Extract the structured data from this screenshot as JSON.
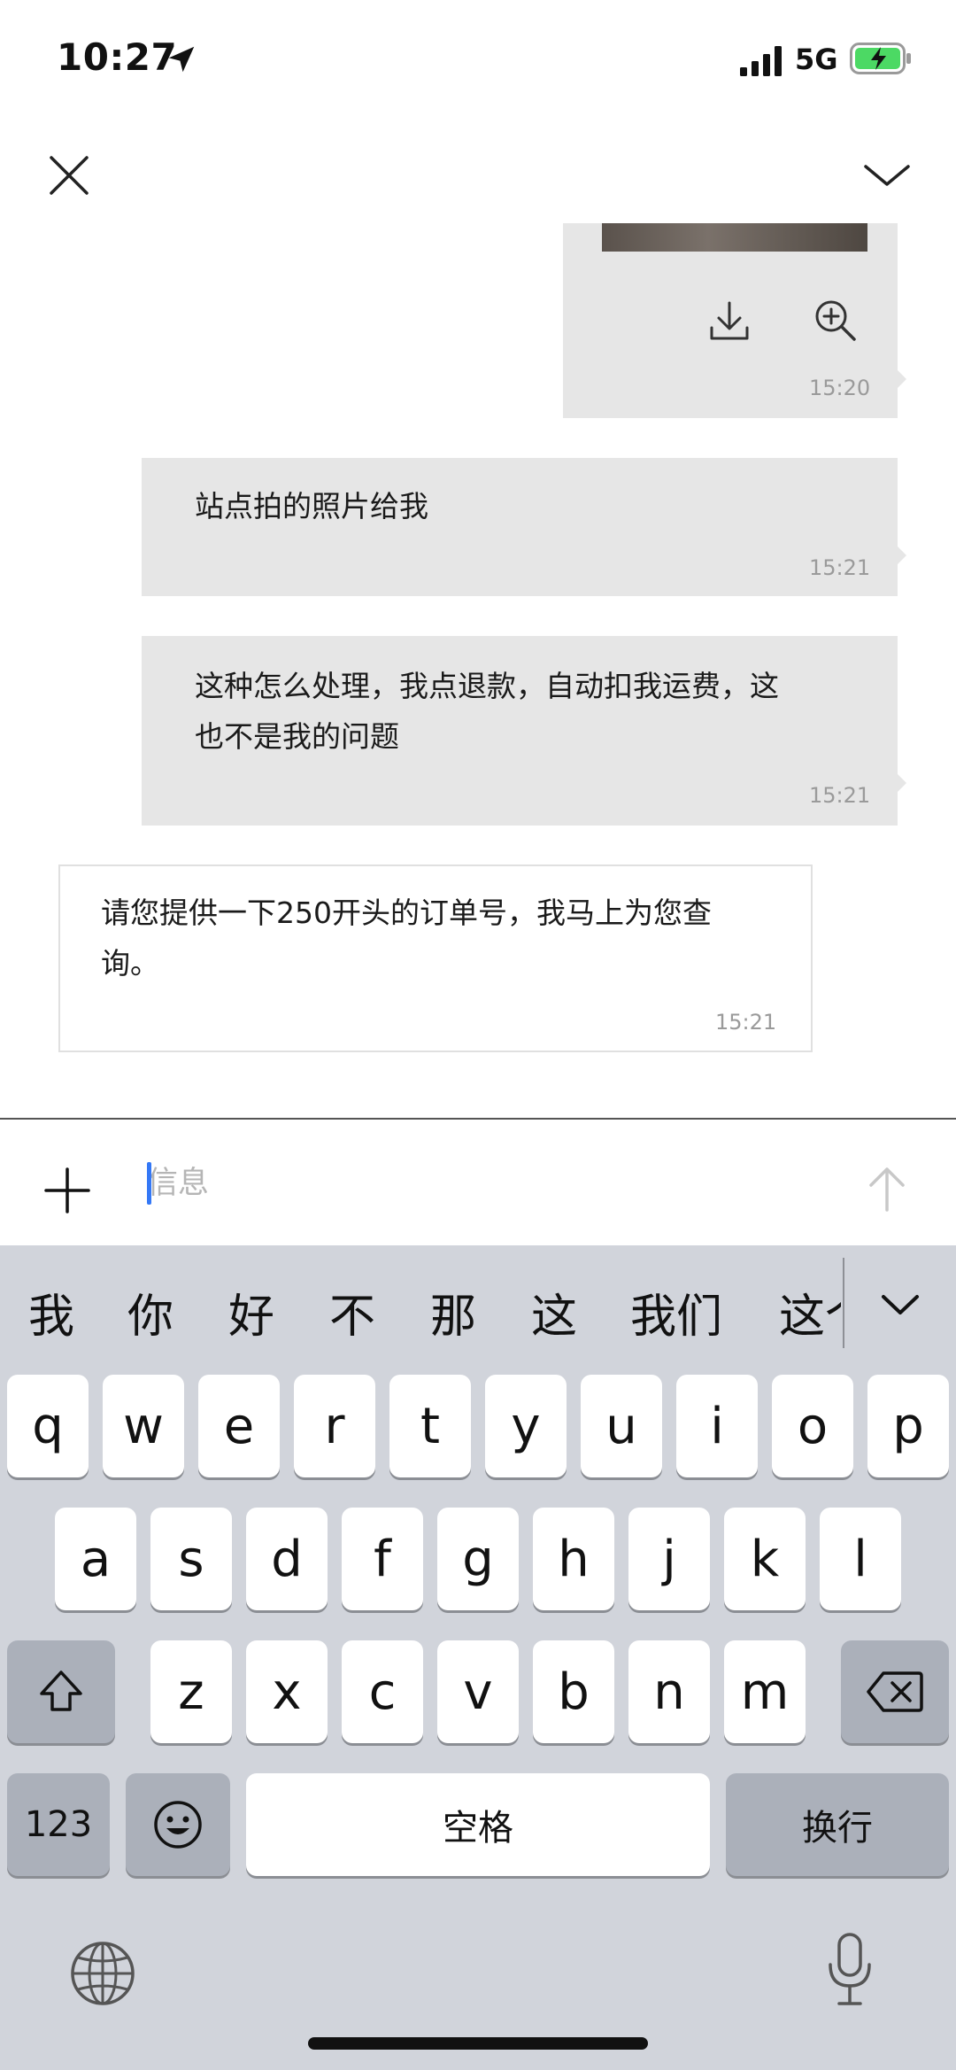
{
  "status_bar": {
    "time": "10:27",
    "network": "5G",
    "battery_color": "#4cd964"
  },
  "header": {
    "close_icon": "close-icon",
    "collapse_icon": "chevron-down-icon"
  },
  "messages": [
    {
      "type": "image",
      "from": "me",
      "time": "15:20",
      "actions": [
        "download-icon",
        "zoom-in-icon"
      ]
    },
    {
      "type": "text",
      "from": "me",
      "text": "站点拍的照片给我",
      "time": "15:21"
    },
    {
      "type": "text",
      "from": "me",
      "text_lines": [
        "这种怎么处理，我点退款，自动扣我运费，这",
        "也不是我的问题"
      ],
      "time": "15:21"
    },
    {
      "type": "text",
      "from": "agent",
      "text_lines": [
        "请您提供一下250开头的订单号，我马上为您查",
        "询。"
      ],
      "time": "15:21"
    }
  ],
  "composer": {
    "placeholder": "信息",
    "value": ""
  },
  "keyboard": {
    "suggestions": [
      "我",
      "你",
      "好",
      "不",
      "那",
      "这",
      "我们",
      "这个"
    ],
    "row1": [
      "q",
      "w",
      "e",
      "r",
      "t",
      "y",
      "u",
      "i",
      "o",
      "p"
    ],
    "row2": [
      "a",
      "s",
      "d",
      "f",
      "g",
      "h",
      "j",
      "k",
      "l"
    ],
    "row3": [
      "z",
      "x",
      "c",
      "v",
      "b",
      "n",
      "m"
    ],
    "numbers_label": "123",
    "space_label": "空格",
    "return_label": "换行"
  },
  "colors": {
    "bubble_me": "#e6e6e6",
    "keyboard_bg": "#d1d4db",
    "accent": "#3478f6"
  }
}
